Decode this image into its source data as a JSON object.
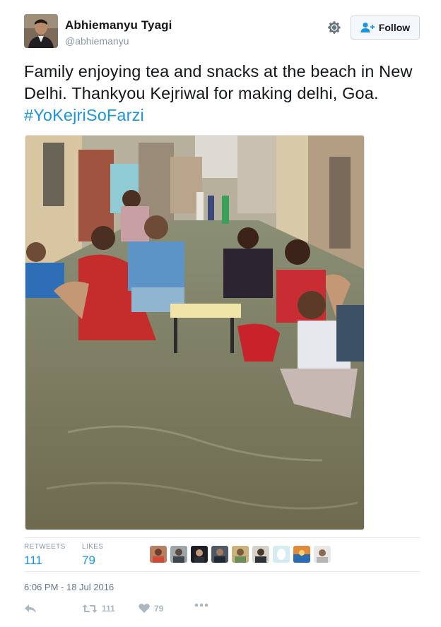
{
  "author": {
    "name": "Abhiemanyu Tyagi",
    "handle": "@abhiemanyu"
  },
  "follow_button": {
    "label": "Follow"
  },
  "tweet": {
    "text_main": "Family enjoying tea and snacks at the beach in New Delhi. Thankyou Kejriwal for making delhi, Goa. ",
    "hashtag": "#YoKejriSoFarzi"
  },
  "stats": {
    "retweets_label": "RETWEETS",
    "retweets_value": "111",
    "likes_label": "LIKES",
    "likes_value": "79"
  },
  "timestamp": "6:06 PM - 18 Jul 2016",
  "actions": {
    "retweet_count": "111",
    "like_count": "79"
  },
  "colors": {
    "link": "#1b95e0",
    "muted": "#8899a6",
    "action_gray": "#aab8c2",
    "divider": "#e1e8ed"
  },
  "icons": [
    "gear-icon",
    "follow-person-icon",
    "reply-icon",
    "retweet-icon",
    "heart-icon",
    "more-icon"
  ]
}
